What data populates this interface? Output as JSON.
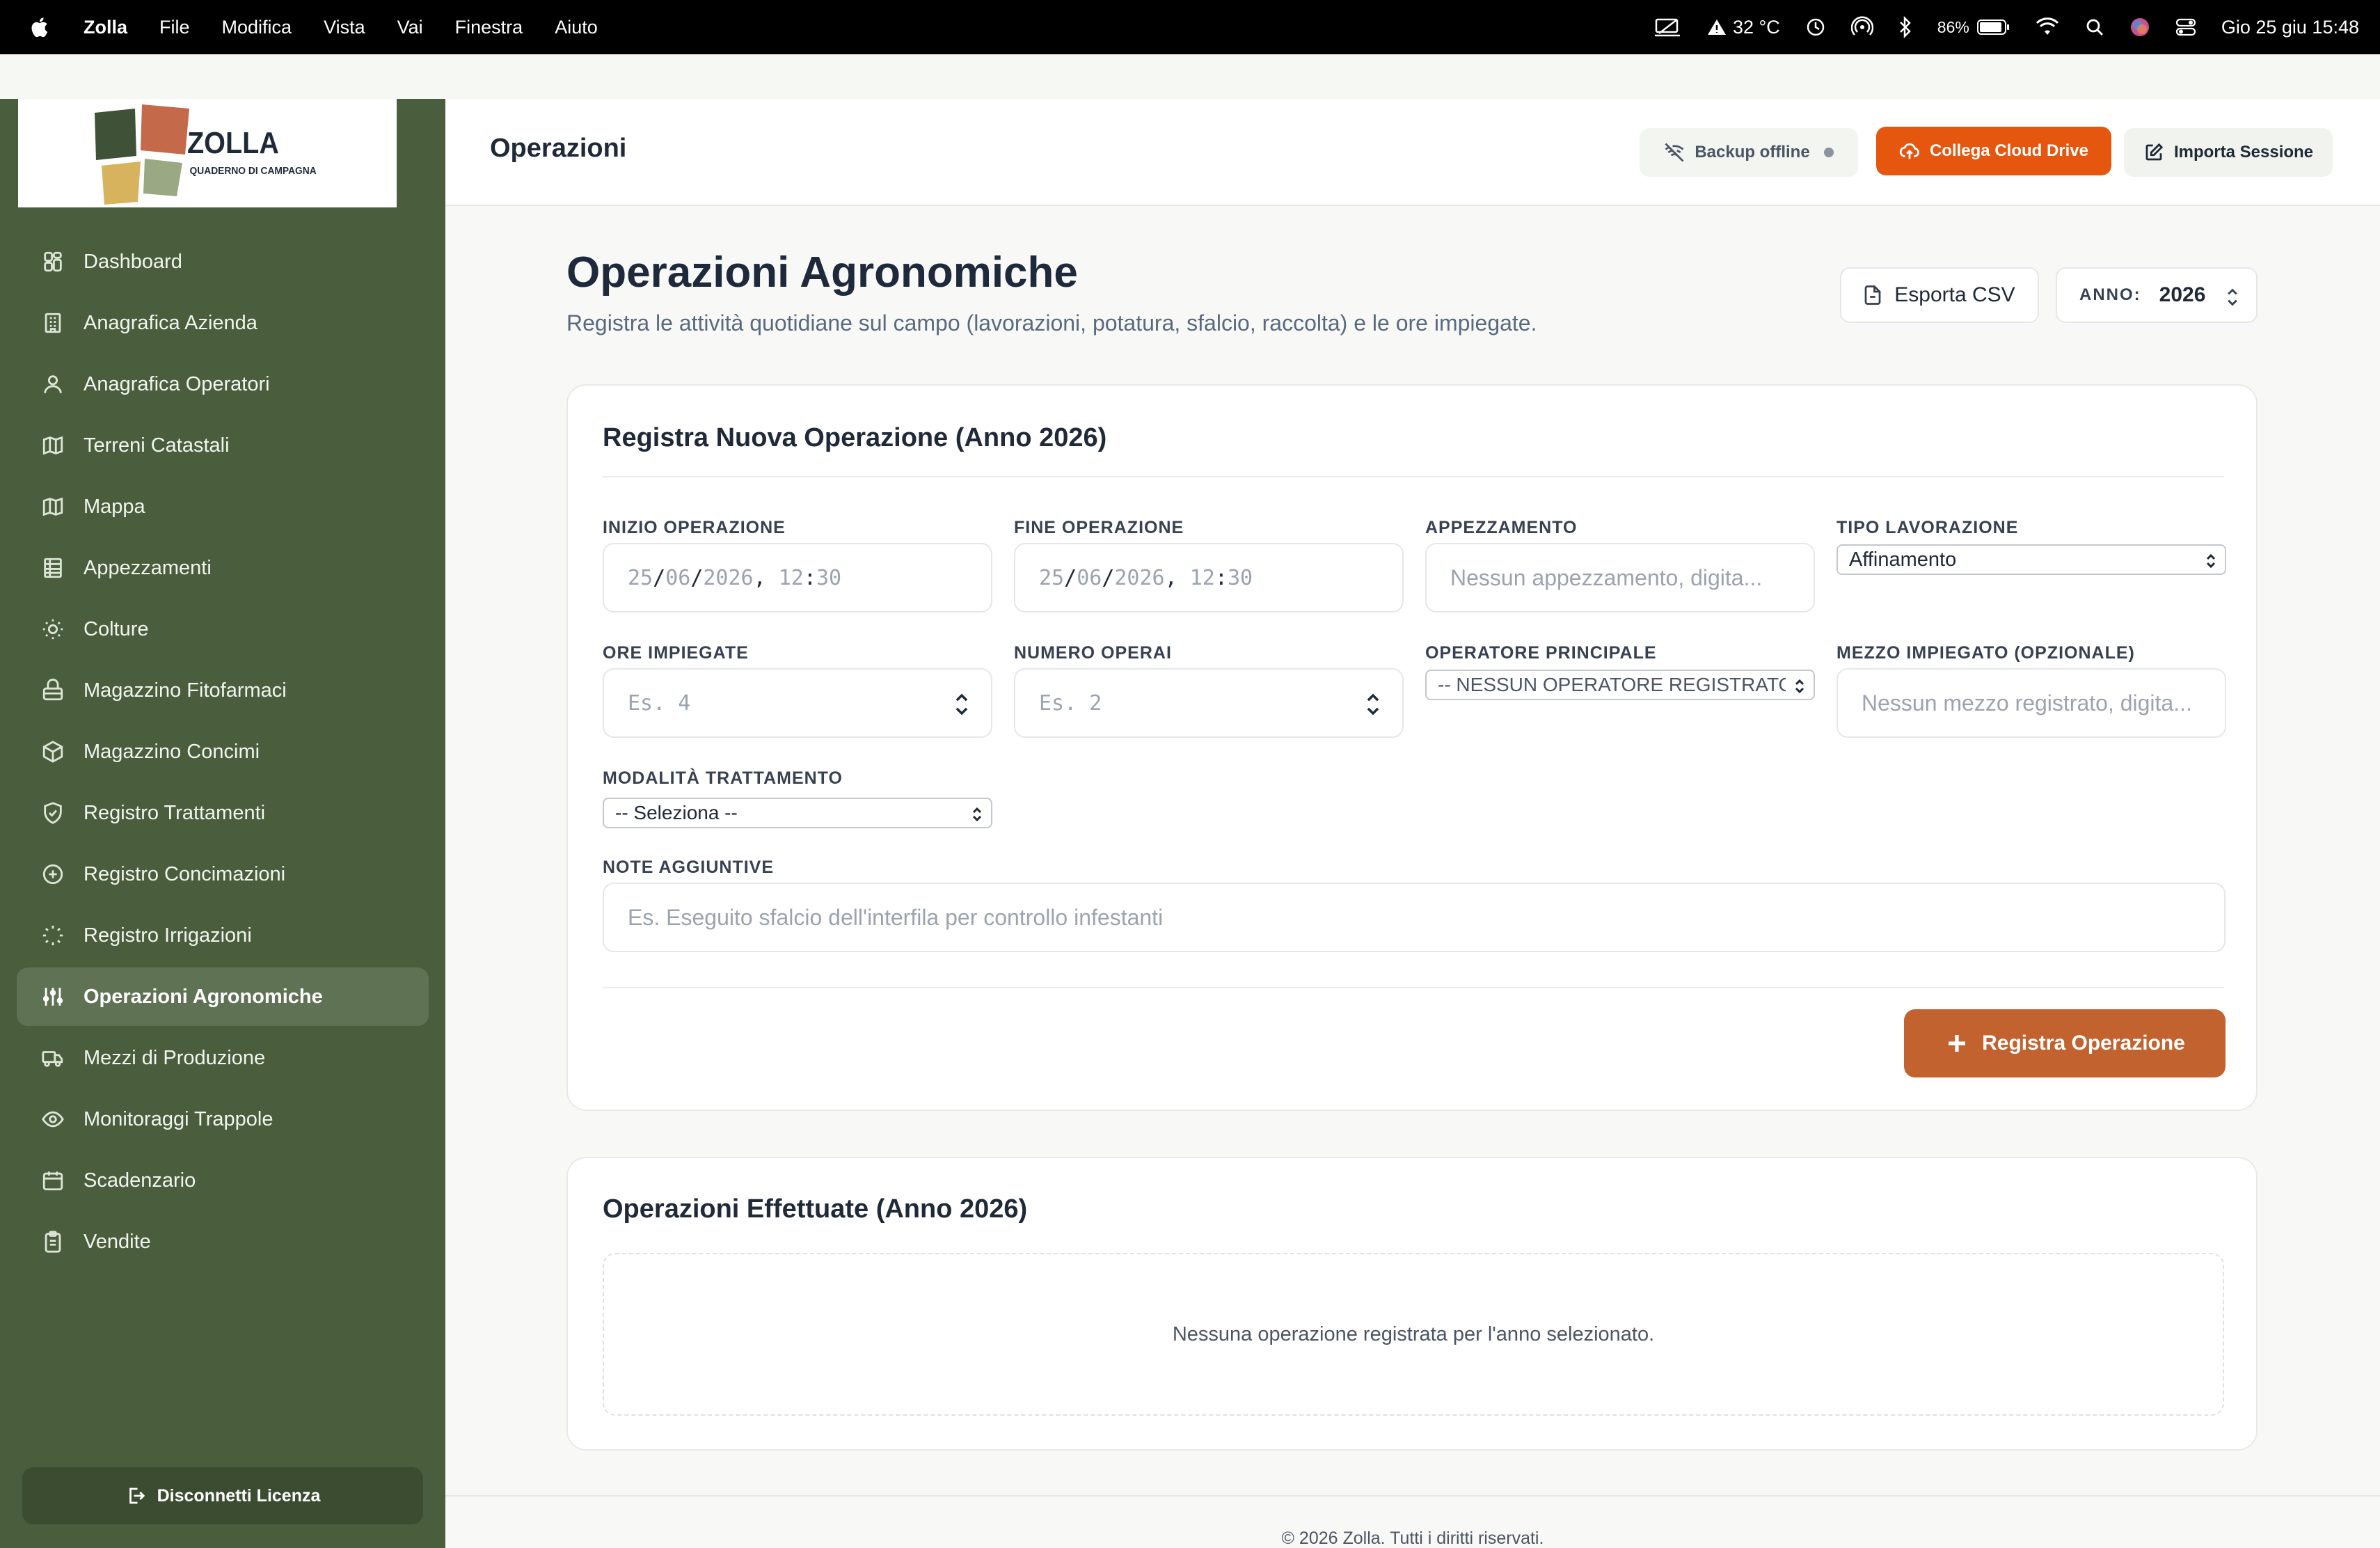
{
  "menubar": {
    "app_name": "Zolla",
    "menus": [
      "File",
      "Modifica",
      "Vista",
      "Vai",
      "Finestra",
      "Aiuto"
    ],
    "temperature": "32 °C",
    "battery": "86%",
    "datetime": "Gio 25 giu  15:48"
  },
  "brand": {
    "name": "ZOLLA",
    "tagline": "QUADERNO DI CAMPAGNA",
    "colors": {
      "dark_green": "#3f5237",
      "terracotta": "#c46a4a",
      "ochre": "#d8b35e",
      "sage": "#9aa884"
    }
  },
  "sidebar": {
    "items": [
      {
        "label": "Dashboard",
        "icon": "grid-icon"
      },
      {
        "label": "Anagrafica Azienda",
        "icon": "building-icon"
      },
      {
        "label": "Anagrafica Operatori",
        "icon": "users-icon"
      },
      {
        "label": "Terreni Catastali",
        "icon": "map-icon"
      },
      {
        "label": "Mappa",
        "icon": "map-icon"
      },
      {
        "label": "Appezzamenti",
        "icon": "table-icon"
      },
      {
        "label": "Colture",
        "icon": "sun-icon"
      },
      {
        "label": "Magazzino Fitofarmaci",
        "icon": "cabinet-icon"
      },
      {
        "label": "Magazzino Concimi",
        "icon": "box-icon"
      },
      {
        "label": "Registro Trattamenti",
        "icon": "shield-icon"
      },
      {
        "label": "Registro Concimazioni",
        "icon": "plus-circle-icon"
      },
      {
        "label": "Registro Irrigazioni",
        "icon": "loader-icon"
      },
      {
        "label": "Operazioni Agronomiche",
        "icon": "sliders-icon",
        "active": true
      },
      {
        "label": "Mezzi di Produzione",
        "icon": "truck-icon"
      },
      {
        "label": "Monitoraggi Trappole",
        "icon": "eye-icon"
      },
      {
        "label": "Scadenzario",
        "icon": "calendar-icon"
      },
      {
        "label": "Vendite",
        "icon": "clipboard-icon"
      }
    ],
    "disconnect_label": "Disconnetti Licenza"
  },
  "header": {
    "title": "Operazioni",
    "backup_label": "Backup offline",
    "cloud_label": "Collega Cloud Drive",
    "import_label": "Importa Sessione"
  },
  "page": {
    "title": "Operazioni Agronomiche",
    "subtitle": "Registra le attività quotidiane sul campo (lavorazioni, potatura, sfalcio, raccolta) e le ore impiegate.",
    "export_label": "Esporta CSV",
    "year_label": "ANNO:",
    "year_value": "2026"
  },
  "form": {
    "title": "Registra Nuova Operazione (Anno 2026)",
    "start": {
      "label": "INIZIO OPERAZIONE",
      "day": "25",
      "month": "06",
      "year": "2026",
      "hour": "12",
      "minute": "30"
    },
    "end": {
      "label": "FINE OPERAZIONE",
      "day": "25",
      "month": "06",
      "year": "2026",
      "hour": "12",
      "minute": "30"
    },
    "plot": {
      "label": "APPEZZAMENTO",
      "placeholder": "Nessun appezzamento, digita..."
    },
    "work_type": {
      "label": "TIPO LAVORAZIONE",
      "value": "Affinamento"
    },
    "hours": {
      "label": "ORE IMPIEGATE",
      "placeholder": "Es. 4"
    },
    "workers": {
      "label": "NUMERO OPERAI",
      "placeholder": "Es. 2"
    },
    "operator": {
      "label": "OPERATORE PRINCIPALE",
      "value": "-- NESSUN OPERATORE REGISTRATO --"
    },
    "vehicle": {
      "label": "MEZZO IMPIEGATO (OPZIONALE)",
      "placeholder": "Nessun mezzo registrato, digita..."
    },
    "treatment_mode": {
      "label": "MODALITÀ TRATTAMENTO",
      "value": "-- Seleziona --"
    },
    "notes": {
      "label": "NOTE AGGIUNTIVE",
      "placeholder": "Es. Eseguito sfalcio dell'interfila per controllo infestanti"
    },
    "submit_label": "Registra Operazione"
  },
  "list": {
    "title": "Operazioni Effettuate (Anno 2026)",
    "empty_message": "Nessuna operazione registrata per l'anno selezionato."
  },
  "footer": {
    "text": "© 2026 Zolla. Tutti i diritti riservati."
  }
}
